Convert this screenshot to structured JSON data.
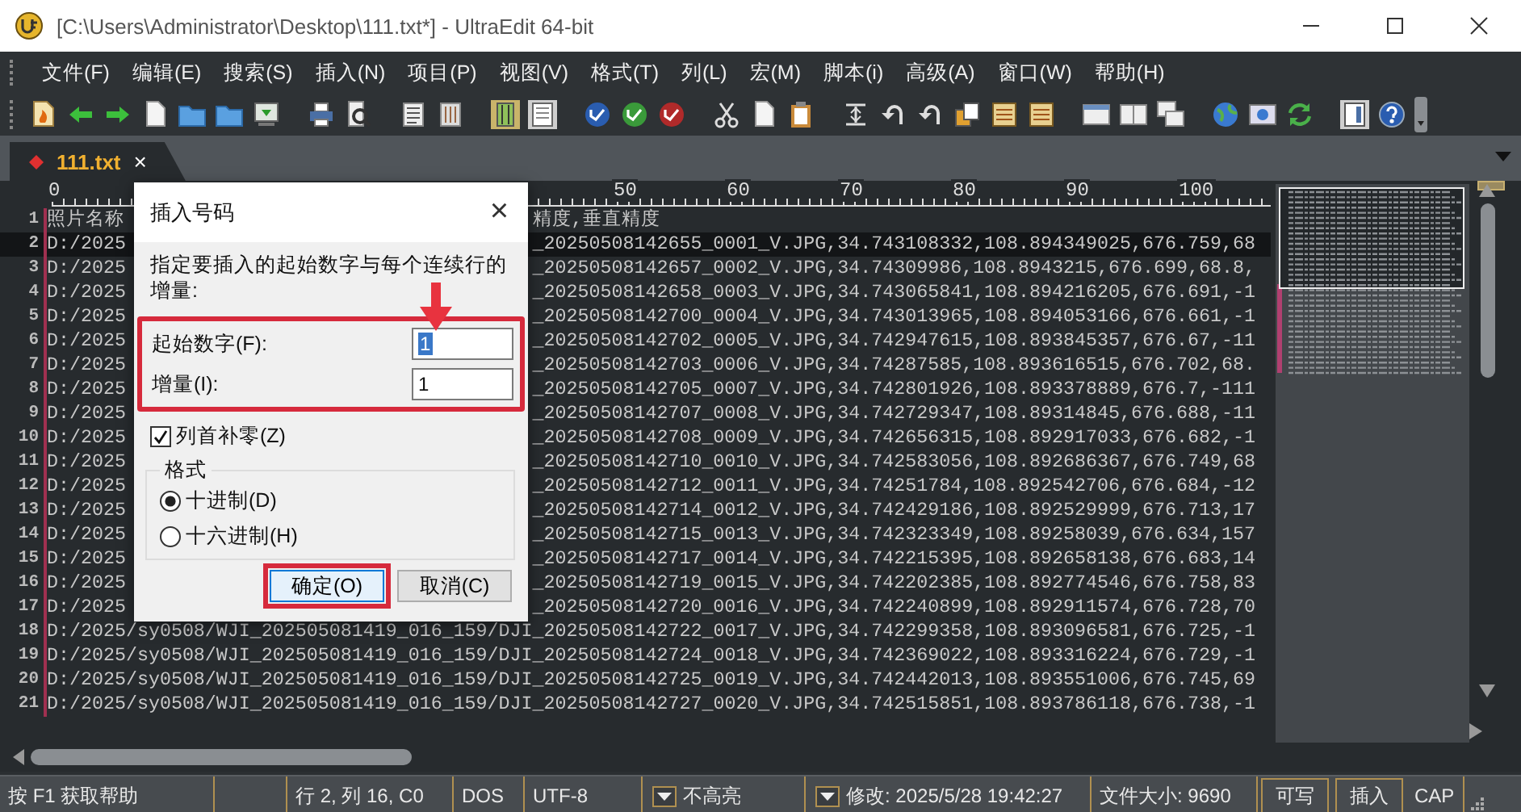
{
  "window": {
    "title": "[C:\\Users\\Administrator\\Desktop\\111.txt*] - UltraEdit 64-bit"
  },
  "menu": [
    "文件(F)",
    "编辑(E)",
    "搜索(S)",
    "插入(N)",
    "项目(P)",
    "视图(V)",
    "格式(T)",
    "列(L)",
    "宏(M)",
    "脚本(i)",
    "高级(A)",
    "窗口(W)",
    "帮助(H)"
  ],
  "tabs": [
    {
      "label": "111.txt",
      "selected": true,
      "modified": true,
      "close": "×"
    }
  ],
  "ruler": {
    "labels": [
      "0",
      "50",
      "60",
      "70",
      "80",
      "90",
      "100"
    ]
  },
  "editor": {
    "lines": [
      {
        "number": "1",
        "current": false,
        "segments": [
          "照片名称",
          "精度,垂直精度"
        ]
      },
      {
        "number": "2",
        "current": true,
        "segments": [
          "D:/2025",
          "_20250508142655_0001_V.JPG,34.743108332,108.894349025,676.759,68"
        ]
      },
      {
        "number": "3",
        "current": false,
        "segments": [
          "D:/2025",
          "_20250508142657_0002_V.JPG,34.74309986,108.8943215,676.699,68.8,"
        ]
      },
      {
        "number": "4",
        "current": false,
        "segments": [
          "D:/2025",
          "_20250508142658_0003_V.JPG,34.743065841,108.894216205,676.691,-1"
        ]
      },
      {
        "number": "5",
        "current": false,
        "segments": [
          "D:/2025",
          "_20250508142700_0004_V.JPG,34.743013965,108.894053166,676.661,-1"
        ]
      },
      {
        "number": "6",
        "current": false,
        "segments": [
          "D:/2025",
          "_20250508142702_0005_V.JPG,34.742947615,108.893845357,676.67,-11"
        ]
      },
      {
        "number": "7",
        "current": false,
        "segments": [
          "D:/2025",
          "_20250508142703_0006_V.JPG,34.74287585,108.893616515,676.702,68."
        ]
      },
      {
        "number": "8",
        "current": false,
        "segments": [
          "D:/2025",
          "_20250508142705_0007_V.JPG,34.742801926,108.893378889,676.7,-111"
        ]
      },
      {
        "number": "9",
        "current": false,
        "segments": [
          "D:/2025",
          "_20250508142707_0008_V.JPG,34.742729347,108.89314845,676.688,-11"
        ]
      },
      {
        "number": "10",
        "current": false,
        "segments": [
          "D:/2025",
          "_20250508142708_0009_V.JPG,34.742656315,108.892917033,676.682,-1"
        ]
      },
      {
        "number": "11",
        "current": false,
        "segments": [
          "D:/2025",
          "_20250508142710_0010_V.JPG,34.742583056,108.892686367,676.749,68"
        ]
      },
      {
        "number": "12",
        "current": false,
        "segments": [
          "D:/2025",
          "_20250508142712_0011_V.JPG,34.74251784,108.892542706,676.684,-12"
        ]
      },
      {
        "number": "13",
        "current": false,
        "segments": [
          "D:/2025",
          "_20250508142714_0012_V.JPG,34.742429186,108.892529999,676.713,17"
        ]
      },
      {
        "number": "14",
        "current": false,
        "segments": [
          "D:/2025",
          "_20250508142715_0013_V.JPG,34.742323349,108.89258039,676.634,157"
        ]
      },
      {
        "number": "15",
        "current": false,
        "segments": [
          "D:/2025",
          "_20250508142717_0014_V.JPG,34.742215395,108.892658138,676.683,14"
        ]
      },
      {
        "number": "16",
        "current": false,
        "segments": [
          "D:/2025",
          "_20250508142719_0015_V.JPG,34.742202385,108.892774546,676.758,83"
        ]
      },
      {
        "number": "17",
        "current": false,
        "segments": [
          "D:/2025",
          "_20250508142720_0016_V.JPG,34.742240899,108.892911574,676.728,70"
        ]
      },
      {
        "number": "18",
        "current": false,
        "segments": [
          "D:/2025/sy0508/WJI_202505081419_016_159/DJI_20250508142722_0017_V.JPG,34.742299358,108.893096581,676.725,-1"
        ]
      },
      {
        "number": "19",
        "current": false,
        "segments": [
          "D:/2025/sy0508/WJI_202505081419_016_159/DJI_20250508142724_0018_V.JPG,34.742369022,108.893316224,676.729,-1"
        ]
      },
      {
        "number": "20",
        "current": false,
        "segments": [
          "D:/2025/sy0508/WJI_202505081419_016_159/DJI_20250508142725_0019_V.JPG,34.742442013,108.893551006,676.745,69"
        ]
      },
      {
        "number": "21",
        "current": false,
        "segments": [
          "D:/2025/sy0508/WJI_202505081419_016_159/DJI_20250508142727_0020_V.JPG,34.742515851,108.893786118,676.738,-1"
        ]
      }
    ]
  },
  "dialog": {
    "title": "插入号码",
    "close": "×",
    "instruction": "指定要插入的起始数字与每个连续行的增量:",
    "fields": [
      {
        "label": "起始数字(F):",
        "value": "1",
        "selected": true
      },
      {
        "label": "增量(I):",
        "value": "1",
        "selected": false
      }
    ],
    "pad_zero": {
      "label": "列首补零(Z)",
      "checked": true
    },
    "format": {
      "legend": "格式",
      "options": [
        {
          "label": "十进制(D)",
          "selected": true
        },
        {
          "label": "十六进制(H)",
          "selected": false
        }
      ]
    },
    "buttons": [
      {
        "label": "确定(O)",
        "default": true
      },
      {
        "label": "取消(C)",
        "default": false
      }
    ]
  },
  "status_bar": {
    "help": "按 F1 获取帮助",
    "position": "行 2, 列 16, C0",
    "line_ending": "DOS",
    "encoding": "UTF-8",
    "highlight": "不高亮",
    "modified": "修改:  2025/5/28 19:42:27",
    "file_size": "文件大小:  9690",
    "write_mode": "可写",
    "insert_mode": "插入",
    "caps": "CAP"
  }
}
